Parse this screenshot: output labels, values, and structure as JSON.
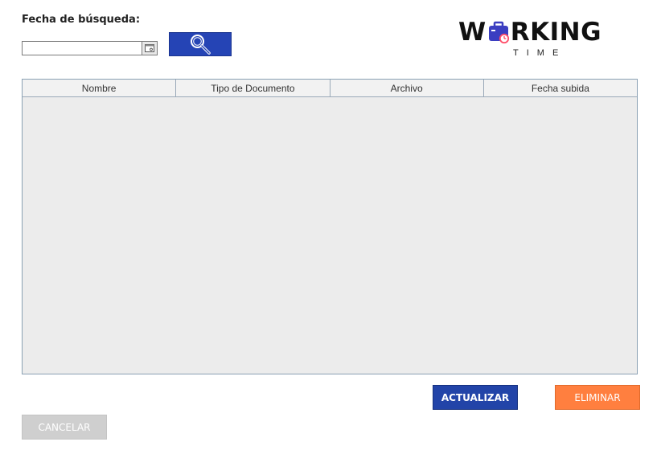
{
  "search": {
    "label": "Fecha de búsqueda:",
    "date_value": "",
    "date_placeholder": ""
  },
  "logo": {
    "word_before": "W",
    "word_after": "RKING",
    "subtitle": "TIME"
  },
  "table": {
    "columns": [
      "Nombre",
      "Tipo de Documento",
      "Archivo",
      "Fecha subida"
    ],
    "rows": []
  },
  "actions": {
    "update_label": "ACTUALIZAR",
    "delete_label": "ELIMINAR",
    "cancel_label": "CANCELAR"
  },
  "colors": {
    "primary_blue": "#2244a8",
    "delete_orange": "#ff7f3f",
    "disabled_gray": "#cfcfcf",
    "logo_bag": "#3b3ec1",
    "logo_accent": "#ff4f6a"
  },
  "icons": {
    "calendar": "calendar-icon",
    "search": "magnifier-icon",
    "logo_bag": "briefcase-clock-icon"
  }
}
